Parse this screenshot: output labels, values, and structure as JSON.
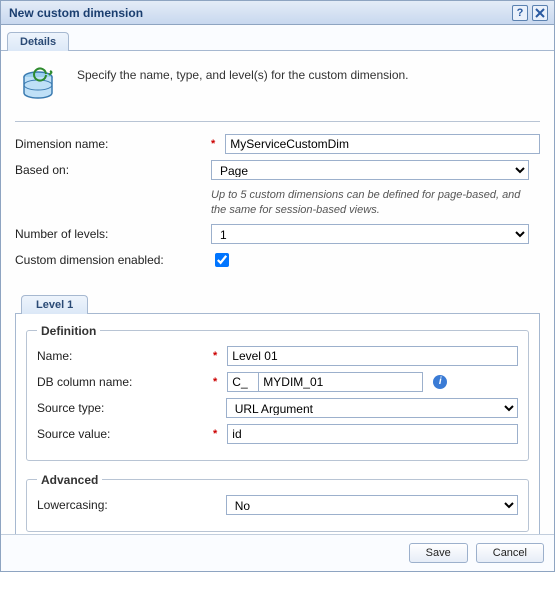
{
  "title": "New custom dimension",
  "tabs": {
    "details": "Details"
  },
  "intro": "Specify the name, type, and level(s) for the custom dimension.",
  "fields": {
    "dimension_name": {
      "label": "Dimension name:",
      "value": "MyServiceCustomDim"
    },
    "based_on": {
      "label": "Based on:",
      "value": "Page",
      "hint": "Up to 5 custom dimensions can be defined for page-based, and the same for session-based views."
    },
    "num_levels": {
      "label": "Number of levels:",
      "value": "1"
    },
    "enabled": {
      "label": "Custom dimension enabled:",
      "checked": true
    }
  },
  "level_tabs": [
    "Level 1"
  ],
  "definition": {
    "legend": "Definition",
    "name": {
      "label": "Name:",
      "value": "Level 01"
    },
    "db_column": {
      "label": "DB column name:",
      "prefix": "C_",
      "suffix": "MYDIM_01"
    },
    "source_type": {
      "label": "Source type:",
      "value": "URL Argument"
    },
    "source_value": {
      "label": "Source value:",
      "value": "id"
    }
  },
  "advanced": {
    "legend": "Advanced",
    "lowercasing": {
      "label": "Lowercasing:",
      "value": "No"
    }
  },
  "buttons": {
    "save": "Save",
    "cancel": "Cancel"
  }
}
